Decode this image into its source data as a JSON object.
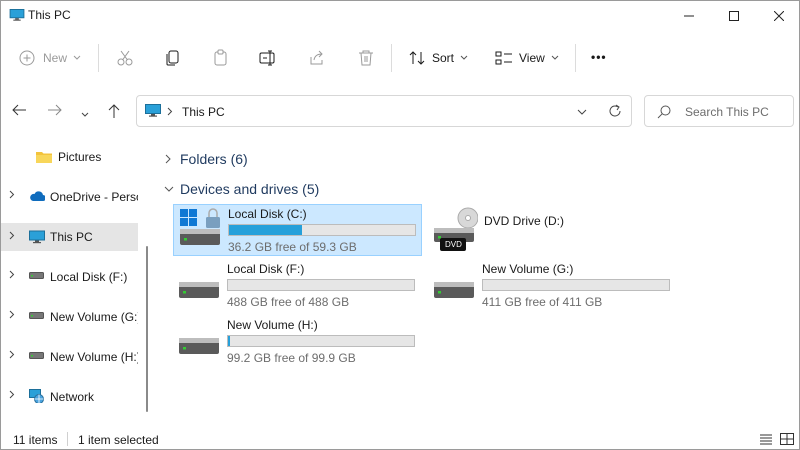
{
  "window": {
    "title": "This PC"
  },
  "toolbar": {
    "new_label": "New",
    "sort_label": "Sort",
    "view_label": "View",
    "more_label": "•••"
  },
  "address": {
    "path": "This PC"
  },
  "search": {
    "placeholder": "Search This PC"
  },
  "sidebar": {
    "items": [
      {
        "label": "Pictures"
      },
      {
        "label": "OneDrive - Perso"
      },
      {
        "label": "This PC"
      },
      {
        "label": "Local Disk (F:)"
      },
      {
        "label": "New Volume (G:)"
      },
      {
        "label": "New Volume (H:)"
      },
      {
        "label": "Network"
      }
    ]
  },
  "main": {
    "folders_label": "Folders (6)",
    "devices_label": "Devices and drives (5)",
    "drives": [
      {
        "name": "Local Disk (C:)",
        "free": "36.2 GB free of 59.3 GB",
        "used_fraction": 0.39,
        "selected": true
      },
      {
        "name": "DVD Drive (D:)",
        "badge": "DVD"
      },
      {
        "name": "Local Disk (F:)",
        "free": "488 GB free of 488 GB",
        "used_fraction": 0.0
      },
      {
        "name": "New Volume (G:)",
        "free": "411 GB free of 411 GB",
        "used_fraction": 0.0
      },
      {
        "name": "New Volume (H:)",
        "free": "99.2 GB free of 99.9 GB",
        "used_fraction": 0.01
      }
    ]
  },
  "status": {
    "items": "11 items",
    "selected": "1 item selected"
  },
  "colors": {
    "accent": "#26a0da",
    "selection": "#cce8ff"
  }
}
